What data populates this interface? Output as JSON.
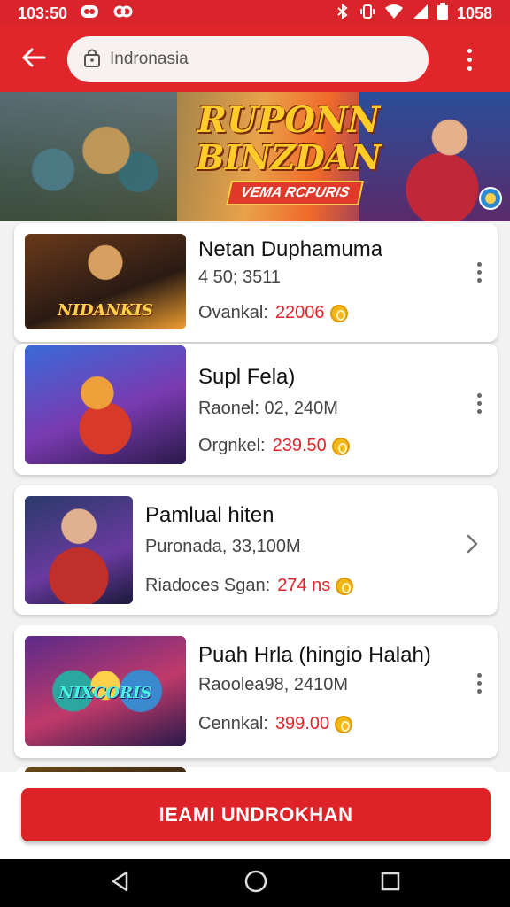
{
  "status_bar": {
    "time": "103:50",
    "clock_right": "1058",
    "icons": [
      "notification-icon",
      "notification-icon",
      "bluetooth-icon",
      "vibrate-icon",
      "wifi-icon",
      "signal-icon",
      "battery-icon"
    ]
  },
  "app_bar": {
    "search_placeholder": "Indronasia",
    "back_icon": "arrow-left-icon",
    "menu_icon": "more-vertical-icon"
  },
  "banner": {
    "title_line1": "RUPONN",
    "title_line2": "BINZDAN",
    "subtitle": "VEMA RCPURIS"
  },
  "items": [
    {
      "title": "Netan Duphamuma",
      "meta": "4 50; 3511",
      "price_label": "Ovankal:",
      "price": "22006",
      "thumb_text": "NIDANKIS",
      "action": "more"
    },
    {
      "title": "Supl Fela)",
      "meta": "Raonel: 02, 240M",
      "price_label": "Orgnkel:",
      "price": "239.50",
      "thumb_text": "",
      "action": "more"
    },
    {
      "title": "Pamlual hiten",
      "meta": "Puronada, 33,100M",
      "price_label": "Riadoces Sgan:",
      "price": "274 ns",
      "thumb_text": "",
      "action": "chevron"
    },
    {
      "title": "Puah Hrla (hingio Halah)",
      "meta": "Raoolea98, 2410M",
      "price_label": "Cennkal:",
      "price": "399.00",
      "thumb_text": "NIXCORIS",
      "action": "more"
    }
  ],
  "cta_label": "IEAMI UNDROKHAN",
  "colors": {
    "brand_red": "#e0262b",
    "price_red": "#e0262b",
    "coin_gold": "#f2b81a"
  }
}
